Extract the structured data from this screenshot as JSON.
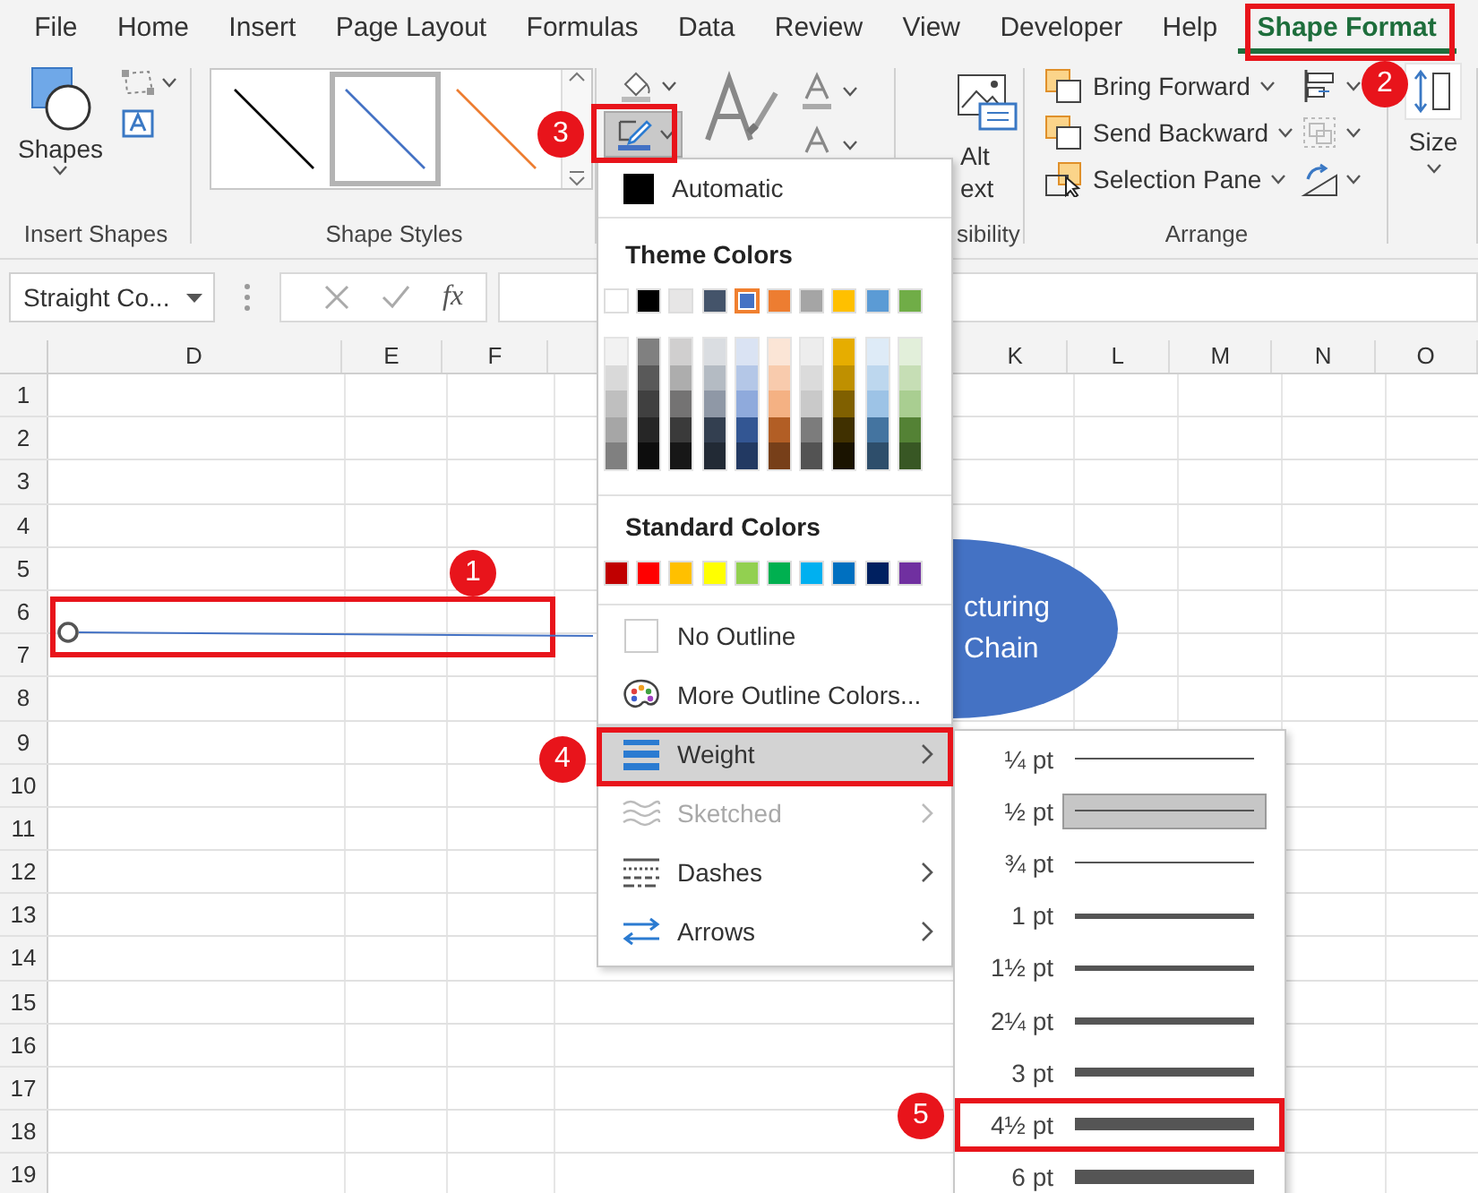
{
  "menu_tabs": [
    {
      "label": "File",
      "selected": false
    },
    {
      "label": "Home",
      "selected": false
    },
    {
      "label": "Insert",
      "selected": false
    },
    {
      "label": "Page Layout",
      "selected": false
    },
    {
      "label": "Formulas",
      "selected": false
    },
    {
      "label": "Data",
      "selected": false
    },
    {
      "label": "Review",
      "selected": false
    },
    {
      "label": "View",
      "selected": false
    },
    {
      "label": "Developer",
      "selected": false
    },
    {
      "label": "Help",
      "selected": false
    },
    {
      "label": "Shape Format",
      "selected": true
    }
  ],
  "ribbon": {
    "insert_shapes": {
      "shapes_button": "Shapes",
      "group_label": "Insert Shapes"
    },
    "shape_styles": {
      "group_label": "Shape Styles",
      "thumbnails": [
        {
          "color": "#000000",
          "selected": false
        },
        {
          "color": "#4472c4",
          "selected": true
        },
        {
          "color": "#ed7d31",
          "selected": false
        }
      ]
    },
    "accessibility": {
      "alt_text_lines": [
        "Alt",
        "ext"
      ],
      "group_label": "sibility"
    },
    "arrange": {
      "buttons": [
        {
          "kind": "bring-forward",
          "label": "Bring Forward"
        },
        {
          "kind": "send-backward",
          "label": "Send Backward"
        },
        {
          "kind": "selection-pane",
          "label": "Selection Pane"
        }
      ],
      "group_label": "Arrange"
    },
    "size": {
      "button": "Size"
    }
  },
  "formula_bar": {
    "name_box": "Straight Co...",
    "function_button": "fx"
  },
  "sheet": {
    "columns": [
      "D",
      "E",
      "F",
      "K",
      "L",
      "M",
      "N",
      "O"
    ],
    "rows": [
      "1",
      "2",
      "3",
      "4",
      "5",
      "6",
      "7",
      "8",
      "9",
      "10",
      "11",
      "12",
      "13",
      "14",
      "15",
      "16",
      "17",
      "18",
      "19"
    ],
    "shapes": [
      {
        "kind": "line"
      },
      {
        "kind": "ellipse",
        "lines": [
          "cturing",
          "Chain"
        ]
      }
    ]
  },
  "outline_menu": {
    "automatic": "Automatic",
    "theme_heading": "Theme Colors",
    "theme_colors": [
      {
        "color": "#ffffff",
        "selected": false
      },
      {
        "color": "#000000",
        "selected": false
      },
      {
        "color": "#e7e6e6",
        "selected": false
      },
      {
        "color": "#44546a",
        "selected": false
      },
      {
        "color": "#4472c4",
        "selected": true
      },
      {
        "color": "#ed7d31",
        "selected": false
      },
      {
        "color": "#a5a5a5",
        "selected": false
      },
      {
        "color": "#ffc000",
        "selected": false
      },
      {
        "color": "#5b9bd5",
        "selected": false
      },
      {
        "color": "#70ad47",
        "selected": false
      }
    ],
    "standard_heading": "Standard Colors",
    "standard_colors": [
      {
        "color": "#c00000"
      },
      {
        "color": "#ff0000"
      },
      {
        "color": "#ffc000"
      },
      {
        "color": "#ffff00"
      },
      {
        "color": "#92d050"
      },
      {
        "color": "#00b050"
      },
      {
        "color": "#00b0f0"
      },
      {
        "color": "#0070c0"
      },
      {
        "color": "#002060"
      },
      {
        "color": "#7030a0"
      }
    ],
    "items": [
      {
        "kind": "no-outline",
        "label": "No Outline",
        "submenu": false,
        "disabled": false,
        "selected": false
      },
      {
        "kind": "more-colors",
        "label": "More Outline Colors...",
        "submenu": false,
        "disabled": false,
        "selected": false
      },
      {
        "kind": "weight",
        "label": "Weight",
        "submenu": true,
        "disabled": false,
        "selected": true
      },
      {
        "kind": "sketched",
        "label": "Sketched",
        "submenu": true,
        "disabled": true,
        "selected": false
      },
      {
        "kind": "dashes",
        "label": "Dashes",
        "submenu": true,
        "disabled": false,
        "selected": false
      },
      {
        "kind": "arrows",
        "label": "Arrows",
        "submenu": true,
        "disabled": false,
        "selected": false
      }
    ]
  },
  "weight_menu": {
    "options": [
      {
        "label": "¼ pt",
        "selected": false
      },
      {
        "label": "½ pt",
        "selected": true
      },
      {
        "label": "¾ pt",
        "selected": false
      },
      {
        "label": "1 pt",
        "selected": false
      },
      {
        "label": "1½ pt",
        "selected": false
      },
      {
        "label": "2¼ pt",
        "selected": false
      },
      {
        "label": "3 pt",
        "selected": false
      },
      {
        "label": "4½ pt",
        "selected": false,
        "annotated": true
      },
      {
        "label": "6 pt",
        "selected": false
      }
    ]
  },
  "callouts": [
    {
      "number": "1"
    },
    {
      "number": "2"
    },
    {
      "number": "3"
    },
    {
      "number": "4"
    },
    {
      "number": "5"
    }
  ]
}
